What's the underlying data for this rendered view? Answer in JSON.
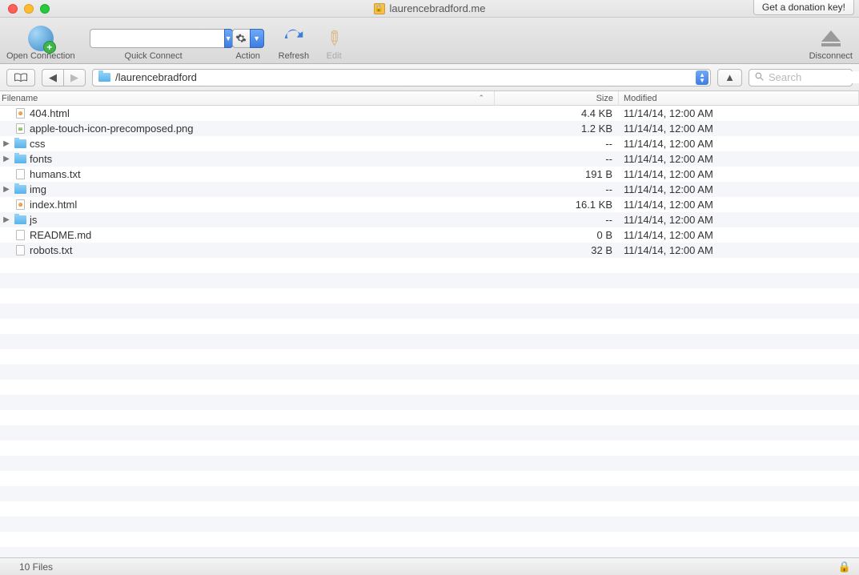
{
  "window": {
    "title": "laurencebradford.me",
    "donation_label": "Get a donation key!"
  },
  "toolbar": {
    "open_connection": "Open Connection",
    "quick_connect": "Quick Connect",
    "action": "Action",
    "refresh": "Refresh",
    "edit": "Edit",
    "disconnect": "Disconnect"
  },
  "pathbar": {
    "path": "/laurencebradford",
    "search_placeholder": "Search"
  },
  "columns": {
    "filename": "Filename",
    "size": "Size",
    "modified": "Modified"
  },
  "files": [
    {
      "name": "404.html",
      "type": "html",
      "size": "4.4 KB",
      "modified": "11/14/14, 12:00 AM",
      "expandable": false
    },
    {
      "name": "apple-touch-icon-precomposed.png",
      "type": "img",
      "size": "1.2 KB",
      "modified": "11/14/14, 12:00 AM",
      "expandable": false
    },
    {
      "name": "css",
      "type": "folder",
      "size": "--",
      "modified": "11/14/14, 12:00 AM",
      "expandable": true
    },
    {
      "name": "fonts",
      "type": "folder",
      "size": "--",
      "modified": "11/14/14, 12:00 AM",
      "expandable": true
    },
    {
      "name": "humans.txt",
      "type": "doc",
      "size": "191 B",
      "modified": "11/14/14, 12:00 AM",
      "expandable": false
    },
    {
      "name": "img",
      "type": "folder",
      "size": "--",
      "modified": "11/14/14, 12:00 AM",
      "expandable": true
    },
    {
      "name": "index.html",
      "type": "html",
      "size": "16.1 KB",
      "modified": "11/14/14, 12:00 AM",
      "expandable": false
    },
    {
      "name": "js",
      "type": "folder",
      "size": "--",
      "modified": "11/14/14, 12:00 AM",
      "expandable": true
    },
    {
      "name": "README.md",
      "type": "doc",
      "size": "0 B",
      "modified": "11/14/14, 12:00 AM",
      "expandable": false
    },
    {
      "name": "robots.txt",
      "type": "doc",
      "size": "32 B",
      "modified": "11/14/14, 12:00 AM",
      "expandable": false
    }
  ],
  "status": {
    "count": "10 Files"
  }
}
